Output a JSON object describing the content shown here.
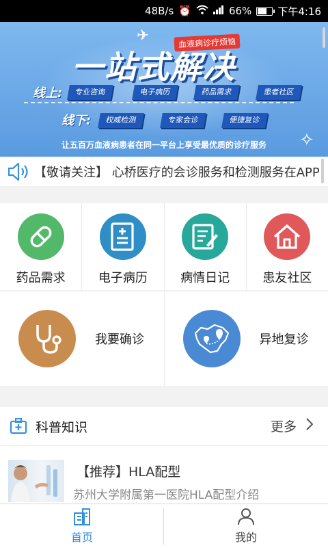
{
  "status_bar": {
    "speed": "48B/s",
    "battery": "66%",
    "time": "下午4:16"
  },
  "banner": {
    "title": "一站式解决",
    "tag": "血液病诊疗烦恼",
    "online_label": "线上:",
    "offline_label": "线下:",
    "online_chips": [
      "专业咨询",
      "电子病历",
      "药品需求",
      "患者社区"
    ],
    "offline_chips": [
      "权威检测",
      "专家会诊",
      "便捷复诊"
    ],
    "caption": "让五百万血液病患者在同一平台上享受最优质的诊疗服务"
  },
  "notice": {
    "text": "【敬请关注】 心桥医疗的会诊服务和检测服务在APP"
  },
  "features": [
    {
      "label": "药品需求",
      "color": "#52b86a"
    },
    {
      "label": "电子病历",
      "color": "#2f8ec5"
    },
    {
      "label": "病情日记",
      "color": "#27a89b"
    },
    {
      "label": "患友社区",
      "color": "#e0585a"
    }
  ],
  "features2": [
    {
      "label": "我要确诊",
      "color": "#c98c4f"
    },
    {
      "label": "异地复诊",
      "color": "#4a8ad4"
    }
  ],
  "science": {
    "title": "科普知识",
    "more": "更多"
  },
  "article": {
    "title": "【推荐】HLA配型",
    "subtitle": "苏州大学附属第一医院HLA配型介绍"
  },
  "tabs": [
    {
      "label": "首页",
      "icon": "home-building-icon"
    },
    {
      "label": "我的",
      "icon": "person-icon"
    }
  ],
  "colors": {
    "accent": "#2f8ee0"
  }
}
